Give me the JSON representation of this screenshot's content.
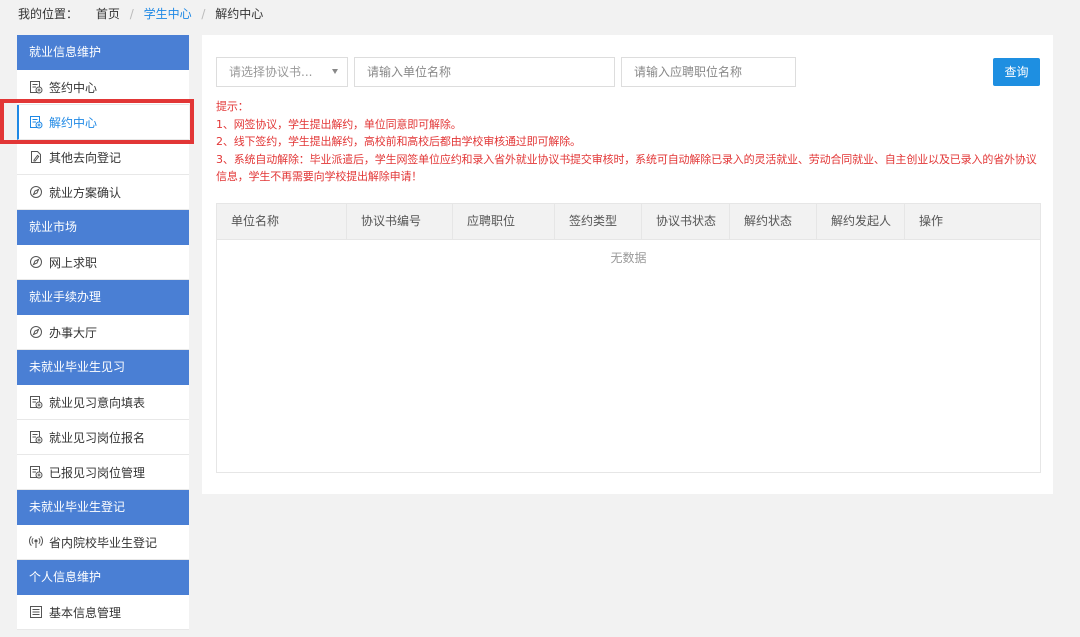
{
  "breadcrumb": {
    "label": "我的位置：",
    "items": [
      "首页",
      "学生中心",
      "解约中心"
    ]
  },
  "sidebar": {
    "groups": [
      {
        "title": "就业信息维护",
        "items": [
          {
            "label": "签约中心",
            "icon": "doc-icon"
          },
          {
            "label": "解约中心",
            "icon": "doc-icon",
            "active": true
          },
          {
            "label": "其他去向登记",
            "icon": "edit-doc-icon"
          },
          {
            "label": "就业方案确认",
            "icon": "compass-icon"
          }
        ]
      },
      {
        "title": "就业市场",
        "items": [
          {
            "label": "网上求职",
            "icon": "compass-icon"
          }
        ]
      },
      {
        "title": "就业手续办理",
        "items": [
          {
            "label": "办事大厅",
            "icon": "compass-icon"
          }
        ]
      },
      {
        "title": "未就业毕业生见习",
        "items": [
          {
            "label": "就业见习意向填表",
            "icon": "doc-icon"
          },
          {
            "label": "就业见习岗位报名",
            "icon": "doc-icon"
          },
          {
            "label": "已报见习岗位管理",
            "icon": "doc-icon"
          }
        ]
      },
      {
        "title": "未就业毕业生登记",
        "items": [
          {
            "label": "省内院校毕业生登记",
            "icon": "broadcast-icon"
          }
        ]
      },
      {
        "title": "个人信息维护",
        "items": [
          {
            "label": "基本信息管理",
            "icon": "list-icon"
          }
        ]
      }
    ]
  },
  "search": {
    "protocol_placeholder": "请选择协议书...",
    "unit_placeholder": "请输入单位名称",
    "position_placeholder": "请输入应聘职位名称",
    "query_label": "查询"
  },
  "tips": {
    "title": "提示：",
    "lines": [
      "1、网签协议，学生提出解约，单位同意即可解除。",
      "2、线下签约，学生提出解约，高校前和高校后都由学校审核通过即可解除。",
      "3、系统自动解除：毕业派遣后，学生网签单位应约和录入省外就业协议书提交审核时，系统可自动解除已录入的灵活就业、劳动合同就业、自主创业以及已录入的省外协议信息，学生不再需要向学校提出解除申请！"
    ]
  },
  "table": {
    "columns": [
      "单位名称",
      "协议书编号",
      "应聘职位",
      "签约类型",
      "协议书状态",
      "解约状态",
      "解约发起人",
      "操作"
    ],
    "empty_text": "无数据"
  },
  "colors": {
    "accent": "#1e88e5",
    "group_bg": "#4a7fd4",
    "tip": "#e23636",
    "highlight": "#e23636"
  }
}
